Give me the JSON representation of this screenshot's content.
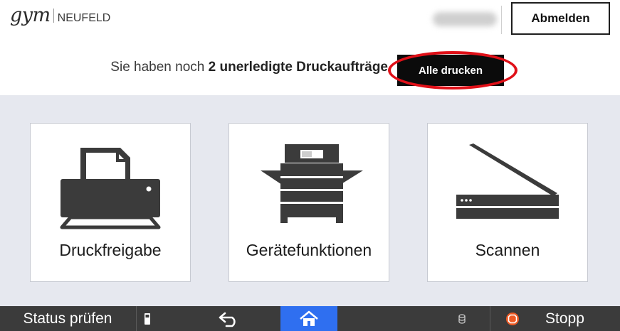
{
  "header": {
    "logo": {
      "brand": "gym",
      "name": "NEUFELD"
    },
    "user": {
      "name_redacted": true
    },
    "logout_label": "Abmelden",
    "notice": {
      "prefix": "Sie haben noch",
      "count": "2",
      "suffix": "unerledigte Druckaufträge"
    },
    "print_all_label": "Alle drucken",
    "highlight_color": "#e01018"
  },
  "tiles": [
    {
      "id": "release",
      "label": "Druckfreigabe",
      "icon": "printer-icon"
    },
    {
      "id": "device",
      "label": "Gerätefunktionen",
      "icon": "copier-icon"
    },
    {
      "id": "scan",
      "label": "Scannen",
      "icon": "scanner-icon"
    }
  ],
  "statusbar": {
    "status_label": "Status prüfen",
    "home_color": "#2f6ff0",
    "stop_label": "Stopp",
    "icons": [
      "memory-card-icon",
      "back-arrow-icon",
      "home-icon",
      "data-indicator-icon",
      "stop-icon"
    ]
  },
  "colors": {
    "main_background": "#e6e8ef",
    "statusbar_background": "#3b3b3b",
    "icon_color": "#3b3b3b",
    "stop_icon_color": "#ee5a24"
  }
}
